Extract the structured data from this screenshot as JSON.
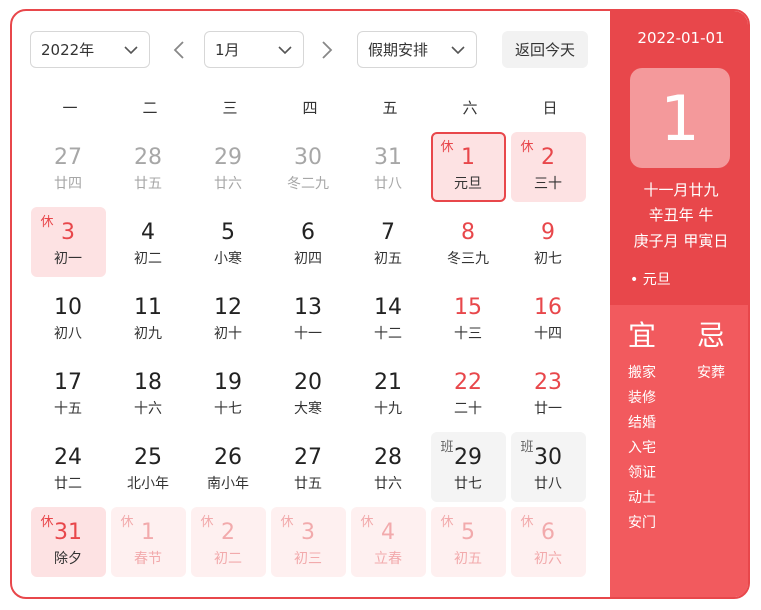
{
  "controls": {
    "year": "2022年",
    "month": "1月",
    "holiday_select": "假期安排",
    "today_button": "返回今天"
  },
  "weekdays": [
    "一",
    "二",
    "三",
    "四",
    "五",
    "六",
    "日"
  ],
  "days": [
    {
      "num": "27",
      "lunar": "廿四",
      "type": "other"
    },
    {
      "num": "28",
      "lunar": "廿五",
      "type": "other"
    },
    {
      "num": "29",
      "lunar": "廿六",
      "type": "other"
    },
    {
      "num": "30",
      "lunar": "冬二九",
      "type": "other"
    },
    {
      "num": "31",
      "lunar": "廿八",
      "type": "other"
    },
    {
      "num": "1",
      "lunar": "元旦",
      "type": "rest",
      "badge": "休",
      "selected": true
    },
    {
      "num": "2",
      "lunar": "三十",
      "type": "rest",
      "badge": "休"
    },
    {
      "num": "3",
      "lunar": "初一",
      "type": "rest",
      "badge": "休"
    },
    {
      "num": "4",
      "lunar": "初二",
      "type": "normal"
    },
    {
      "num": "5",
      "lunar": "小寒",
      "type": "normal"
    },
    {
      "num": "6",
      "lunar": "初四",
      "type": "normal"
    },
    {
      "num": "7",
      "lunar": "初五",
      "type": "normal"
    },
    {
      "num": "8",
      "lunar": "冬三九",
      "type": "weekend"
    },
    {
      "num": "9",
      "lunar": "初七",
      "type": "weekend"
    },
    {
      "num": "10",
      "lunar": "初八",
      "type": "normal"
    },
    {
      "num": "11",
      "lunar": "初九",
      "type": "normal"
    },
    {
      "num": "12",
      "lunar": "初十",
      "type": "normal"
    },
    {
      "num": "13",
      "lunar": "十一",
      "type": "normal"
    },
    {
      "num": "14",
      "lunar": "十二",
      "type": "normal"
    },
    {
      "num": "15",
      "lunar": "十三",
      "type": "weekend"
    },
    {
      "num": "16",
      "lunar": "十四",
      "type": "weekend"
    },
    {
      "num": "17",
      "lunar": "十五",
      "type": "normal"
    },
    {
      "num": "18",
      "lunar": "十六",
      "type": "normal"
    },
    {
      "num": "19",
      "lunar": "十七",
      "type": "normal"
    },
    {
      "num": "20",
      "lunar": "大寒",
      "type": "normal"
    },
    {
      "num": "21",
      "lunar": "十九",
      "type": "normal"
    },
    {
      "num": "22",
      "lunar": "二十",
      "type": "weekend"
    },
    {
      "num": "23",
      "lunar": "廿一",
      "type": "weekend"
    },
    {
      "num": "24",
      "lunar": "廿二",
      "type": "normal"
    },
    {
      "num": "25",
      "lunar": "北小年",
      "type": "normal"
    },
    {
      "num": "26",
      "lunar": "南小年",
      "type": "normal"
    },
    {
      "num": "27",
      "lunar": "廿五",
      "type": "normal"
    },
    {
      "num": "28",
      "lunar": "廿六",
      "type": "normal"
    },
    {
      "num": "29",
      "lunar": "廿七",
      "type": "work",
      "badge": "班"
    },
    {
      "num": "30",
      "lunar": "廿八",
      "type": "work",
      "badge": "班"
    },
    {
      "num": "31",
      "lunar": "除夕",
      "type": "rest",
      "badge": "休"
    },
    {
      "num": "1",
      "lunar": "春节",
      "type": "rest-other",
      "badge": "休"
    },
    {
      "num": "2",
      "lunar": "初二",
      "type": "rest-other",
      "badge": "休"
    },
    {
      "num": "3",
      "lunar": "初三",
      "type": "rest-other",
      "badge": "休"
    },
    {
      "num": "4",
      "lunar": "立春",
      "type": "rest-other",
      "badge": "休"
    },
    {
      "num": "5",
      "lunar": "初五",
      "type": "rest-other",
      "badge": "休"
    },
    {
      "num": "6",
      "lunar": "初六",
      "type": "rest-other",
      "badge": "休"
    }
  ],
  "side": {
    "date": "2022-01-01",
    "big_day": "1",
    "lunar_lines": [
      "十一月廿九",
      "辛丑年 牛",
      "庚子月 甲寅日"
    ],
    "holiday": "• 元旦",
    "yi_label": "宜",
    "ji_label": "忌",
    "yi_items": [
      "搬家",
      "装修",
      "结婚",
      "入宅",
      "领证",
      "动土",
      "安门"
    ],
    "ji_items": [
      "安葬"
    ]
  },
  "colors": {
    "accent": "#e8474b",
    "rest_bg": "#fde2e3",
    "work_bg": "#f4f4f4"
  }
}
